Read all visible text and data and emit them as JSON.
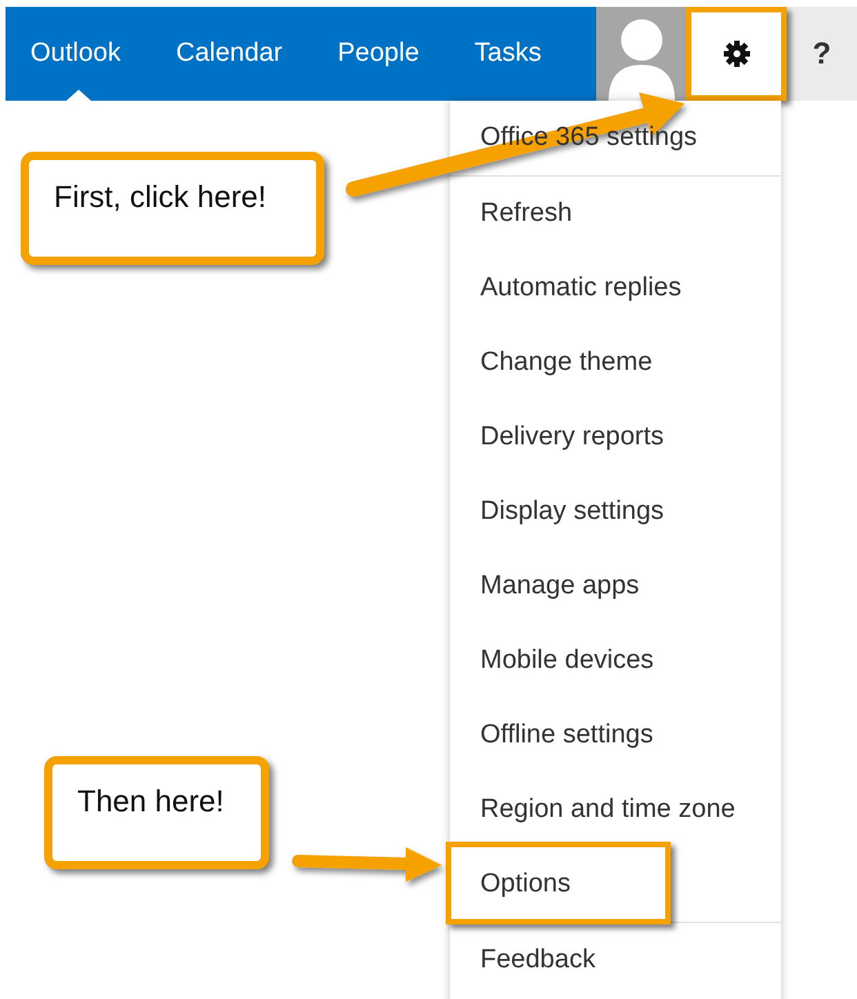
{
  "nav": {
    "tabs": [
      {
        "label": "Outlook",
        "selected": true
      },
      {
        "label": "Calendar",
        "selected": false
      },
      {
        "label": "People",
        "selected": false
      },
      {
        "label": "Tasks",
        "selected": false
      }
    ],
    "settings_highlighted": true,
    "help": "?"
  },
  "settings_menu": {
    "sections": [
      [
        {
          "label": "Office 365 settings",
          "highlighted": false
        }
      ],
      [
        {
          "label": "Refresh",
          "highlighted": false
        },
        {
          "label": "Automatic replies",
          "highlighted": false
        },
        {
          "label": "Change theme",
          "highlighted": false
        },
        {
          "label": "Delivery reports",
          "highlighted": false
        },
        {
          "label": "Display settings",
          "highlighted": false
        },
        {
          "label": "Manage apps",
          "highlighted": false
        },
        {
          "label": "Mobile devices",
          "highlighted": false
        },
        {
          "label": "Offline settings",
          "highlighted": false
        },
        {
          "label": "Region and time zone",
          "highlighted": false
        },
        {
          "label": "Options",
          "highlighted": true
        }
      ],
      [
        {
          "label": "Feedback",
          "highlighted": false
        }
      ]
    ]
  },
  "annotations": [
    {
      "text": "First, click here!"
    },
    {
      "text": "Then here!"
    }
  ]
}
